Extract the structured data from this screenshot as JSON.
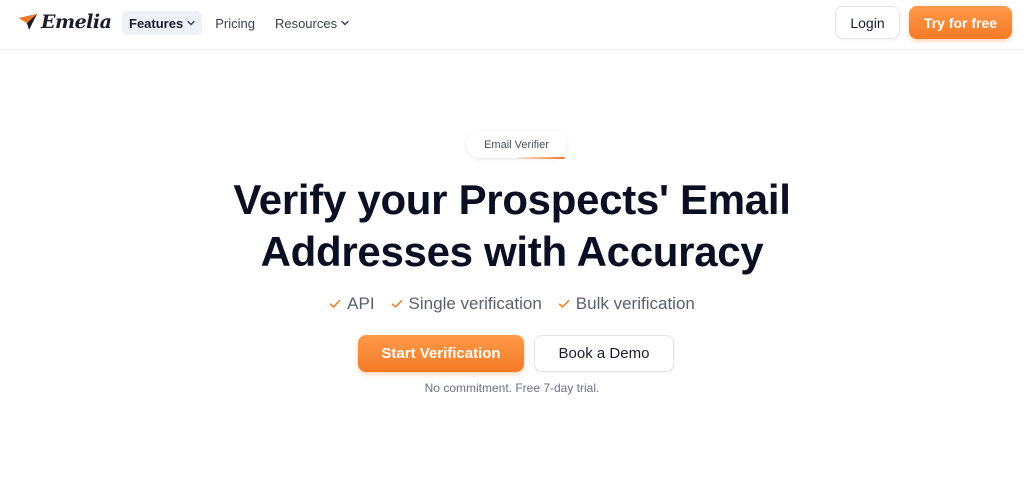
{
  "brand": {
    "name": "Emelia",
    "icon": "paper-plane-icon",
    "accent_color": "#f47a25"
  },
  "nav": {
    "items": [
      {
        "label": "Features",
        "has_dropdown": true,
        "active": true
      },
      {
        "label": "Pricing",
        "has_dropdown": false,
        "active": false
      },
      {
        "label": "Resources",
        "has_dropdown": true,
        "active": false
      }
    ]
  },
  "header_actions": {
    "login_label": "Login",
    "try_label": "Try for free"
  },
  "hero": {
    "badge": "Email Verifier",
    "title_line1": "Verify your Prospects' Email",
    "title_line2": "Addresses with Accuracy",
    "features": [
      {
        "label": "API",
        "icon": "check-icon"
      },
      {
        "label": "Single verification",
        "icon": "check-icon"
      },
      {
        "label": "Bulk verification",
        "icon": "check-icon"
      }
    ],
    "primary_cta": "Start Verification",
    "secondary_cta": "Book a Demo",
    "note": "No commitment. Free 7-day trial."
  }
}
